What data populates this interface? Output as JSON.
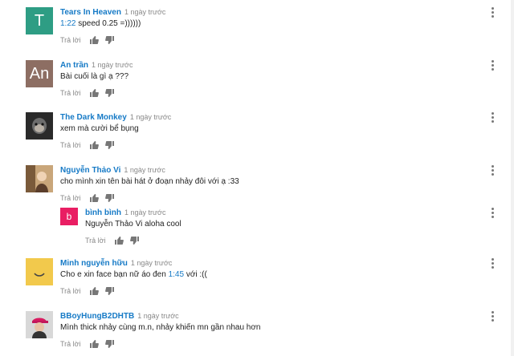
{
  "ui": {
    "reply_label": "Trả lời",
    "more_icon": "vertical-dots-icon",
    "like_icon": "thumb-up-icon",
    "dislike_icon": "thumb-down-icon",
    "accent_color": "#167ac6"
  },
  "comments": [
    {
      "author": "Tears In Heaven",
      "time": "1 ngày trước",
      "avatar_letter": "T",
      "avatar_color": "#2e9d84",
      "text_ts": "1:22",
      "text_rest": " speed 0.25 =))))))"
    },
    {
      "author": "An trần",
      "time": "1 ngày trước",
      "avatar_letter": "An",
      "avatar_color": "#8d6e63",
      "text": "Bài cuối là gì ạ ???"
    },
    {
      "author": "The Dark Monkey",
      "time": "1 ngày trước",
      "avatar_letter": "",
      "avatar_color": "#2a2a2a",
      "text": "xem mà cười bể bụng"
    },
    {
      "author": "Nguyễn Thảo Vi",
      "time": "1 ngày trước",
      "avatar_letter": "",
      "avatar_color": "#a67c52",
      "text": "cho mình xin tên bài hát ở đoạn nhảy đôi với ạ :33"
    },
    {
      "author": "bình bình",
      "time": "1 ngày trước",
      "avatar_letter": "b",
      "avatar_color": "#e91e63",
      "text": "Nguyễn Thảo Vi aloha cool"
    },
    {
      "author": "Minh nguyễn hữu",
      "time": "1 ngày trước",
      "avatar_letter": "",
      "avatar_color": "#e3b83b",
      "text_pre": "Cho e xin face bạn nữ áo đen ",
      "text_ts": "1:45",
      "text_rest": " với :(("
    },
    {
      "author": "BBoyHungB2DHTB",
      "time": "1 ngày trước",
      "avatar_letter": "",
      "avatar_color": "#b0b0b0",
      "text": "Mình thick nhảy cùng m.n, nhảy khiến mn gần nhau hơn"
    }
  ]
}
